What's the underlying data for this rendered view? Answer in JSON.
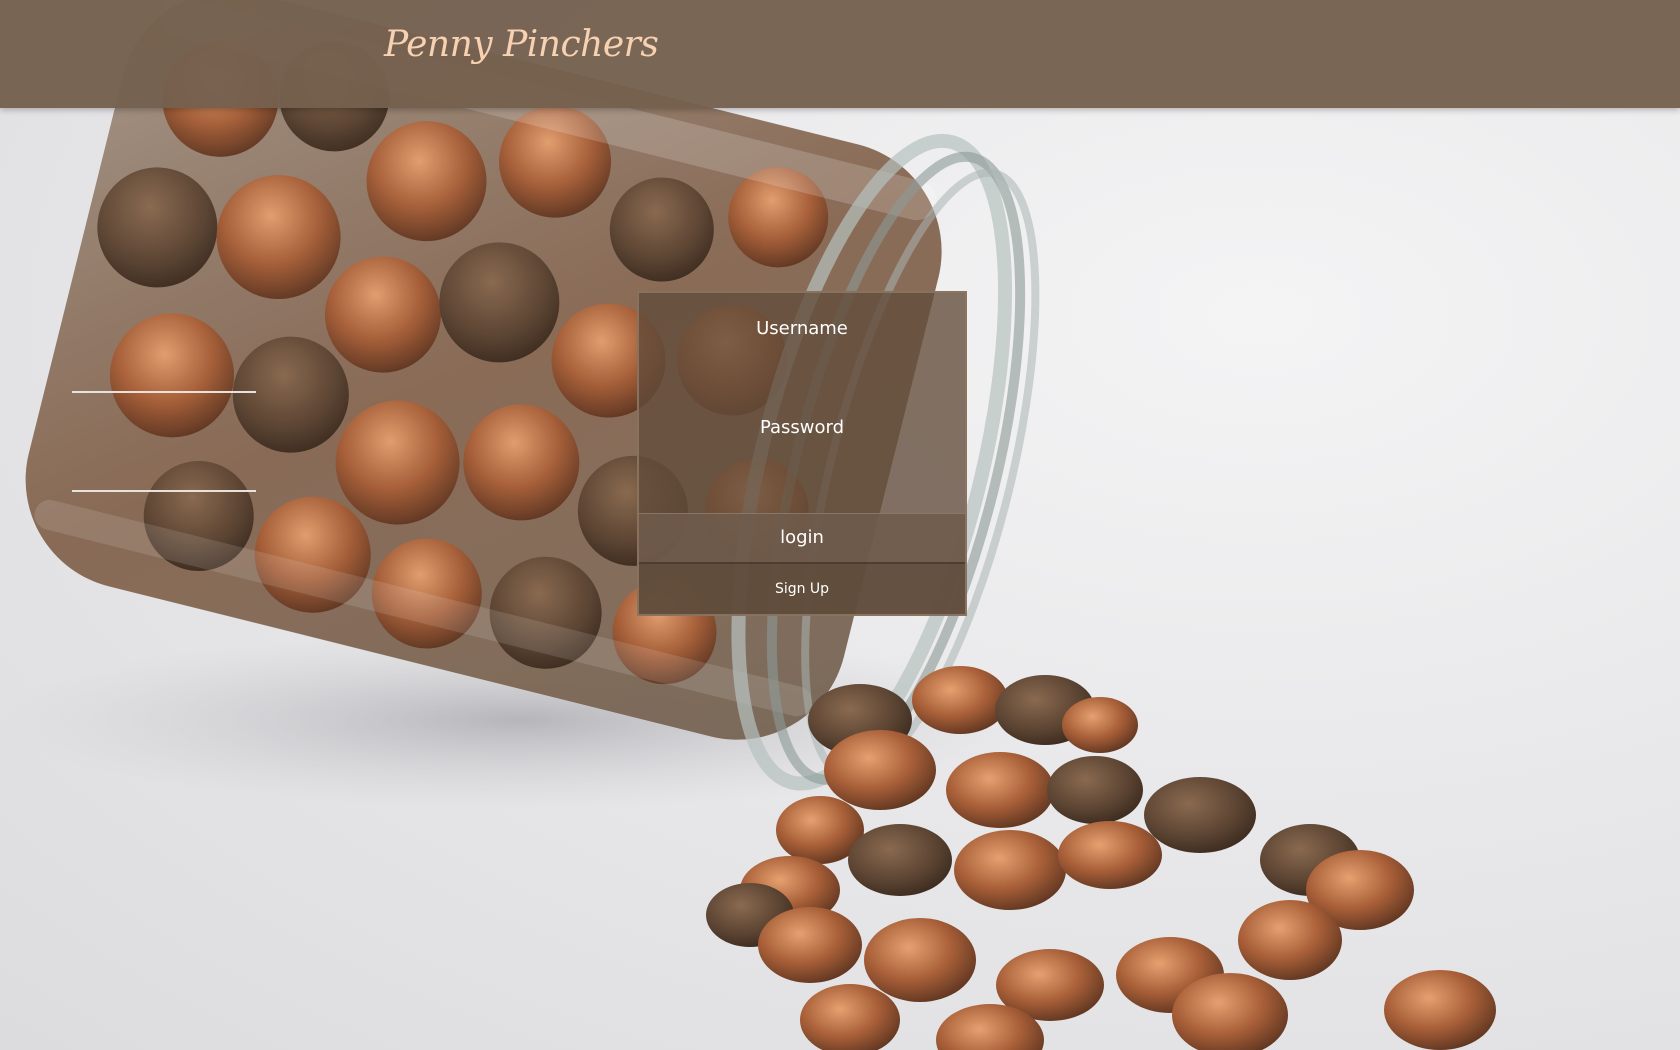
{
  "header": {
    "brand": "Penny Pinchers"
  },
  "login": {
    "username_label": "Username",
    "username_value": "",
    "password_label": "Password",
    "password_value": "",
    "login_label": "login",
    "signup_label": "Sign Up"
  },
  "background": {
    "image_subject": "glass jar of pennies tipped over with coins spilling out"
  },
  "colors": {
    "header": "#75604e",
    "brand_text": "#f6d2b3",
    "panel": "#624c3a",
    "copper": "#b06a40"
  }
}
